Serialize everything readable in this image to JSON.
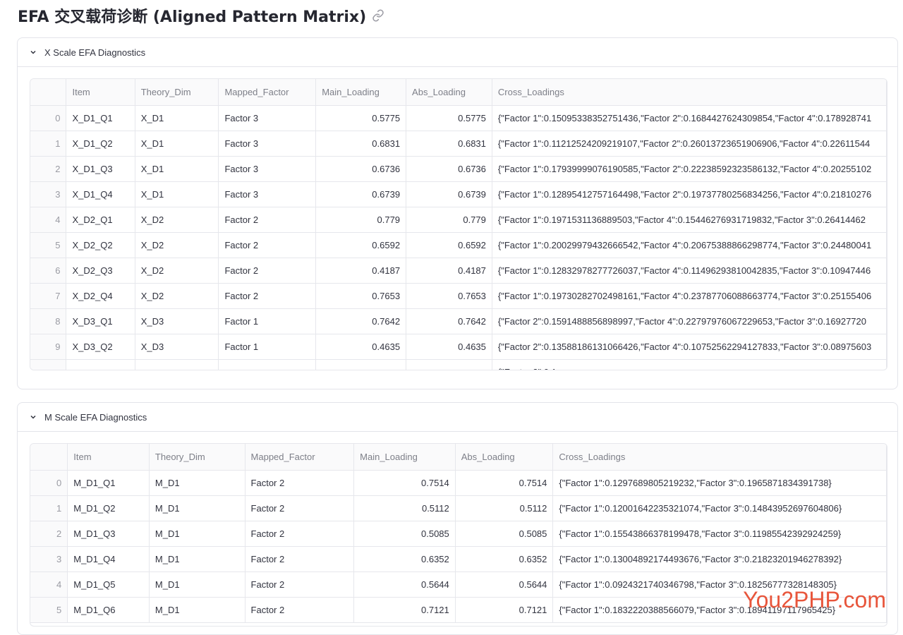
{
  "page": {
    "title": "EFA 交叉载荷诊断 (Aligned Pattern Matrix)",
    "link_icon": "link-icon"
  },
  "x_scale": {
    "header": "X Scale EFA Diagnostics",
    "columns": [
      "",
      "Item",
      "Theory_Dim",
      "Mapped_Factor",
      "Main_Loading",
      "Abs_Loading",
      "Cross_Loadings"
    ],
    "rows": [
      [
        "0",
        "X_D1_Q1",
        "X_D1",
        "Factor 3",
        "0.5775",
        "0.5775",
        "{\"Factor 1\":0.15095338352751436,\"Factor 2\":0.1684427624309854,\"Factor 4\":0.178928741"
      ],
      [
        "1",
        "X_D1_Q2",
        "X_D1",
        "Factor 3",
        "0.6831",
        "0.6831",
        "{\"Factor 1\":0.11212524209219107,\"Factor 2\":0.26013723651906906,\"Factor 4\":0.22611544"
      ],
      [
        "2",
        "X_D1_Q3",
        "X_D1",
        "Factor 3",
        "0.6736",
        "0.6736",
        "{\"Factor 1\":0.17939999076190585,\"Factor 2\":0.22238592323586132,\"Factor 4\":0.20255102"
      ],
      [
        "3",
        "X_D1_Q4",
        "X_D1",
        "Factor 3",
        "0.6739",
        "0.6739",
        "{\"Factor 1\":0.12895412757164498,\"Factor 2\":0.19737780256834256,\"Factor 4\":0.21810276"
      ],
      [
        "4",
        "X_D2_Q1",
        "X_D2",
        "Factor 2",
        "0.779",
        "0.779",
        "{\"Factor 1\":0.1971531136889503,\"Factor 4\":0.15446276931719832,\"Factor 3\":0.26414462"
      ],
      [
        "5",
        "X_D2_Q2",
        "X_D2",
        "Factor 2",
        "0.6592",
        "0.6592",
        "{\"Factor 1\":0.20029979432666542,\"Factor 4\":0.20675388866298774,\"Factor 3\":0.24480041"
      ],
      [
        "6",
        "X_D2_Q3",
        "X_D2",
        "Factor 2",
        "0.4187",
        "0.4187",
        "{\"Factor 1\":0.12832978277726037,\"Factor 4\":0.11496293810042835,\"Factor 3\":0.10947446"
      ],
      [
        "7",
        "X_D2_Q4",
        "X_D2",
        "Factor 2",
        "0.7653",
        "0.7653",
        "{\"Factor 1\":0.19730282702498161,\"Factor 4\":0.23787706088663774,\"Factor 3\":0.25155406"
      ],
      [
        "8",
        "X_D3_Q1",
        "X_D3",
        "Factor 1",
        "0.7642",
        "0.7642",
        "{\"Factor 2\":0.1591488856898997,\"Factor 4\":0.22797976067229653,\"Factor 3\":0.16927720"
      ],
      [
        "9",
        "X_D3_Q2",
        "X_D3",
        "Factor 1",
        "0.4635",
        "0.4635",
        "{\"Factor 2\":0.13588186131066426,\"Factor 4\":0.10752562294127833,\"Factor 3\":0.08975603"
      ],
      [
        "",
        "",
        "",
        "",
        "",
        "",
        "{\"Factor 2\":0.1..."
      ]
    ]
  },
  "m_scale": {
    "header": "M Scale EFA Diagnostics",
    "columns": [
      "",
      "Item",
      "Theory_Dim",
      "Mapped_Factor",
      "Main_Loading",
      "Abs_Loading",
      "Cross_Loadings"
    ],
    "rows": [
      [
        "0",
        "M_D1_Q1",
        "M_D1",
        "Factor 2",
        "0.7514",
        "0.7514",
        "{\"Factor 1\":0.1297689805219232,\"Factor 3\":0.1965871834391738}"
      ],
      [
        "1",
        "M_D1_Q2",
        "M_D1",
        "Factor 2",
        "0.5112",
        "0.5112",
        "{\"Factor 1\":0.12001642235321074,\"Factor 3\":0.14843952697604806}"
      ],
      [
        "2",
        "M_D1_Q3",
        "M_D1",
        "Factor 2",
        "0.5085",
        "0.5085",
        "{\"Factor 1\":0.15543866378199478,\"Factor 3\":0.11985542392924259}"
      ],
      [
        "3",
        "M_D1_Q4",
        "M_D1",
        "Factor 2",
        "0.6352",
        "0.6352",
        "{\"Factor 1\":0.13004892174493676,\"Factor 3\":0.21823201946278392}"
      ],
      [
        "4",
        "M_D1_Q5",
        "M_D1",
        "Factor 2",
        "0.5644",
        "0.5644",
        "{\"Factor 1\":0.0924321740346798,\"Factor 3\":0.18256777328148305}"
      ],
      [
        "5",
        "M_D1_Q6",
        "M_D1",
        "Factor 2",
        "0.7121",
        "0.7121",
        "{\"Factor 1\":0.1832220388566079,\"Factor 3\":0.18941197117965425}"
      ]
    ]
  },
  "watermark": "You2PHP.com"
}
